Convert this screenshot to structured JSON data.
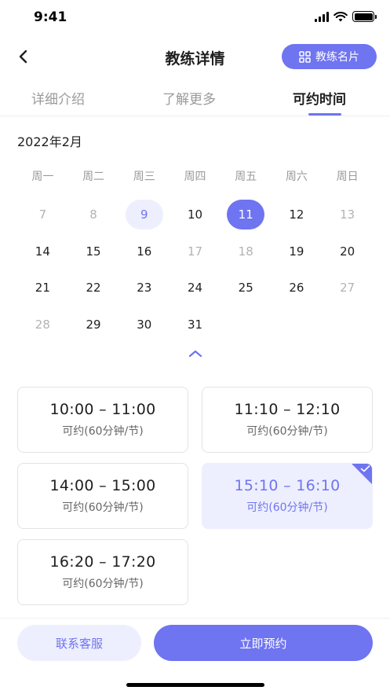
{
  "status_bar": {
    "time": "9:41"
  },
  "nav": {
    "title": "教练详情",
    "card_button_label": "教练名片"
  },
  "tabs": [
    {
      "label": "详细介绍",
      "active": false
    },
    {
      "label": "了解更多",
      "active": false
    },
    {
      "label": "可约时间",
      "active": true
    }
  ],
  "calendar": {
    "month_label": "2022年2月",
    "weekdays": [
      "周一",
      "周二",
      "周三",
      "周四",
      "周五",
      "周六",
      "周日"
    ],
    "days": [
      {
        "label": "7",
        "state": "muted"
      },
      {
        "label": "8",
        "state": "muted"
      },
      {
        "label": "9",
        "state": "today"
      },
      {
        "label": "10",
        "state": "normal"
      },
      {
        "label": "11",
        "state": "selected"
      },
      {
        "label": "12",
        "state": "normal"
      },
      {
        "label": "13",
        "state": "muted"
      },
      {
        "label": "14",
        "state": "normal"
      },
      {
        "label": "15",
        "state": "normal"
      },
      {
        "label": "16",
        "state": "normal"
      },
      {
        "label": "17",
        "state": "muted"
      },
      {
        "label": "18",
        "state": "muted"
      },
      {
        "label": "19",
        "state": "normal"
      },
      {
        "label": "20",
        "state": "normal"
      },
      {
        "label": "21",
        "state": "normal"
      },
      {
        "label": "22",
        "state": "normal"
      },
      {
        "label": "23",
        "state": "normal"
      },
      {
        "label": "24",
        "state": "normal"
      },
      {
        "label": "25",
        "state": "normal"
      },
      {
        "label": "26",
        "state": "normal"
      },
      {
        "label": "27",
        "state": "muted"
      },
      {
        "label": "28",
        "state": "muted"
      },
      {
        "label": "29",
        "state": "normal"
      },
      {
        "label": "30",
        "state": "normal"
      },
      {
        "label": "31",
        "state": "normal"
      }
    ]
  },
  "slots": [
    {
      "time": "10:00 – 11:00",
      "status": "可约(60分钟/节)",
      "selected": false
    },
    {
      "time": "11:10 – 12:10",
      "status": "可约(60分钟/节)",
      "selected": false
    },
    {
      "time": "14:00 – 15:00",
      "status": "可约(60分钟/节)",
      "selected": false
    },
    {
      "time": "15:10 – 16:10",
      "status": "可约(60分钟/节)",
      "selected": true
    },
    {
      "time": "16:20 – 17:20",
      "status": "可约(60分钟/节)",
      "selected": false
    }
  ],
  "bottom": {
    "service_label": "联系客服",
    "book_label": "立即预约"
  },
  "colors": {
    "accent": "#6f74f0",
    "accent_light": "#eeeffe",
    "muted_text": "#b3b3b3"
  },
  "icons": {
    "back": "chevron-left-icon",
    "card": "grid-icon",
    "collapse": "chevron-up-icon",
    "check": "check-icon"
  }
}
